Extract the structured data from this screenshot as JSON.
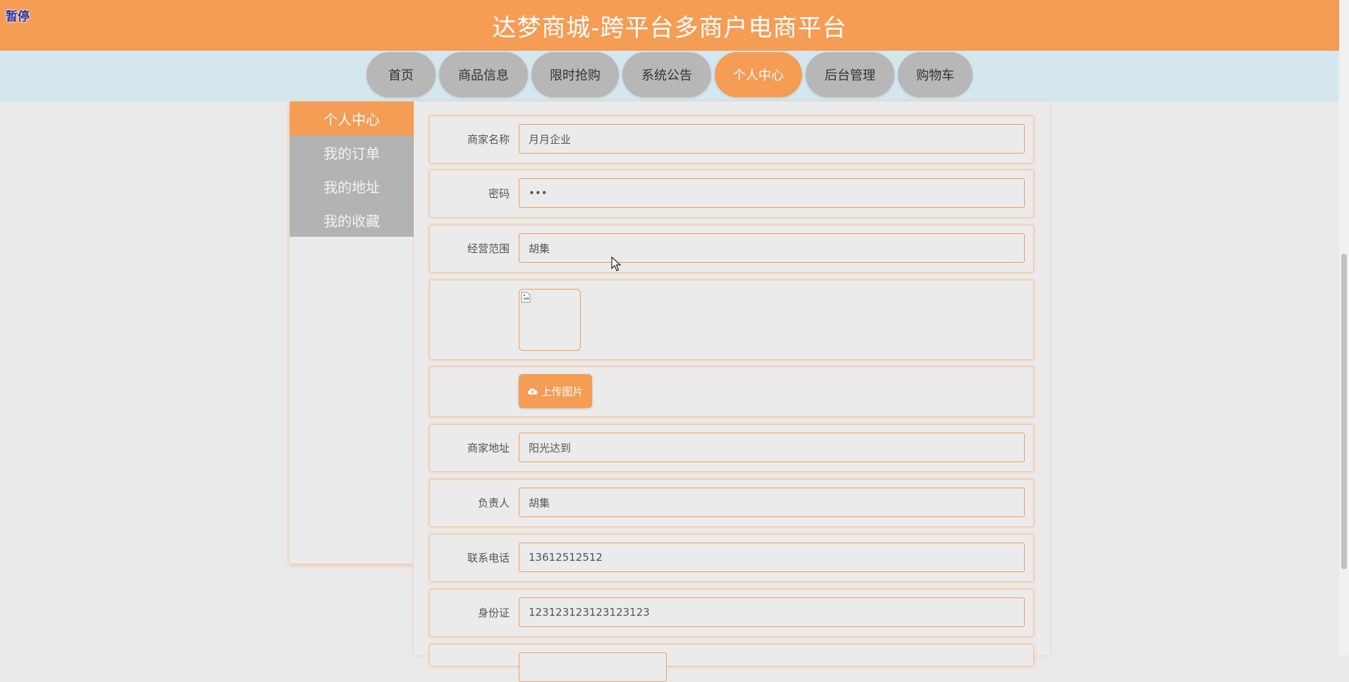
{
  "header": {
    "title": "达梦商城-跨平台多商户电商平台",
    "pause_label": "暂停"
  },
  "nav": {
    "items": [
      {
        "label": "首页"
      },
      {
        "label": "商品信息"
      },
      {
        "label": "限时抢购"
      },
      {
        "label": "系统公告"
      },
      {
        "label": "个人中心",
        "active": true
      },
      {
        "label": "后台管理"
      },
      {
        "label": "购物车"
      }
    ]
  },
  "sidebar": {
    "items": [
      {
        "label": "个人中心",
        "active": true
      },
      {
        "label": "我的订单"
      },
      {
        "label": "我的地址"
      },
      {
        "label": "我的收藏"
      }
    ]
  },
  "form": {
    "merchant_name": {
      "label": "商家名称",
      "value": "月月企业"
    },
    "password": {
      "label": "密码",
      "value": "•••"
    },
    "business_scope": {
      "label": "经营范围",
      "value": "胡集"
    },
    "upload_label": "上传图片",
    "merchant_address": {
      "label": "商家地址",
      "value": "阳光达到"
    },
    "person_in_charge": {
      "label": "负责人",
      "value": "胡集"
    },
    "phone": {
      "label": "联系电话",
      "value": "13612512512"
    },
    "id_card": {
      "label": "身份证",
      "value": "123123123123123123"
    }
  },
  "colors": {
    "accent": "#f59c55",
    "nav_bg": "#d5e7ee",
    "nav_inactive": "#b7b7b7",
    "page_bg": "#eaeaea"
  },
  "icons": [
    "cloud-upload-icon",
    "broken-image-icon",
    "mouse-cursor-icon"
  ]
}
